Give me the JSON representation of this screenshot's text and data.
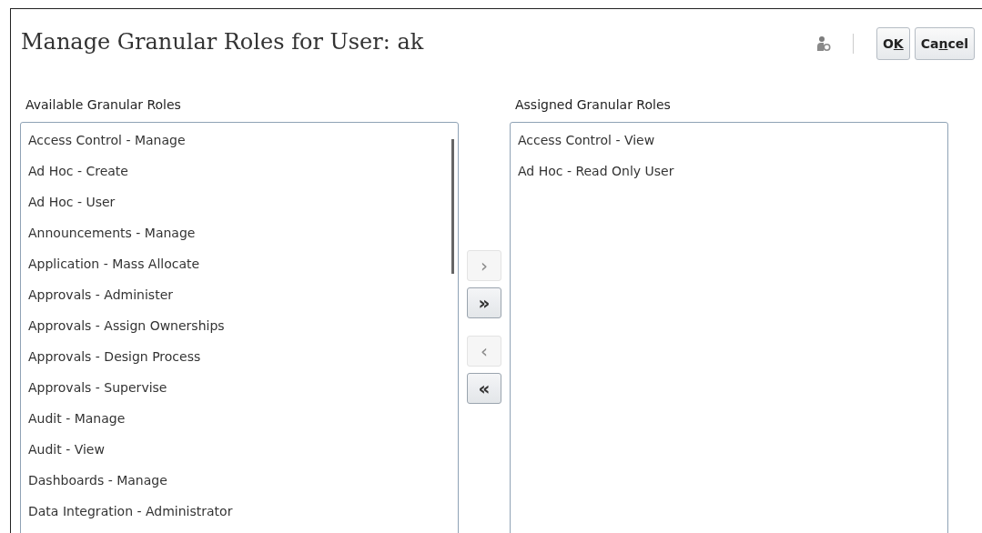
{
  "dialog": {
    "title": "Manage Granular Roles for User: ak",
    "buttons": [
      {
        "parts": [
          {
            "text": "O",
            "underlined": false
          },
          {
            "text": "K",
            "underlined": true
          }
        ]
      },
      {
        "parts": [
          {
            "text": "Ca",
            "underlined": false
          },
          {
            "text": "n",
            "underlined": true
          },
          {
            "text": "cel",
            "underlined": false
          }
        ]
      }
    ]
  },
  "available": {
    "label": "Available Granular Roles",
    "items": [
      {
        "label": "Access Control - Manage"
      },
      {
        "label": "Ad Hoc - Create"
      },
      {
        "label": "Ad Hoc - User"
      },
      {
        "label": "Announcements - Manage"
      },
      {
        "label": "Application - Mass Allocate"
      },
      {
        "label": "Approvals - Administer"
      },
      {
        "label": "Approvals - Assign Ownerships"
      },
      {
        "label": "Approvals - Design Process"
      },
      {
        "label": "Approvals - Supervise"
      },
      {
        "label": "Audit - Manage"
      },
      {
        "label": "Audit - View"
      },
      {
        "label": "Dashboards - Manage"
      },
      {
        "label": "Data Integration - Administrator"
      }
    ]
  },
  "movers": [
    {
      "label": "›",
      "disabled": true
    },
    {
      "label": "»",
      "disabled": false
    },
    {
      "label": "‹",
      "disabled": true
    },
    {
      "label": "«",
      "disabled": false
    }
  ],
  "assigned": {
    "label": "Assigned Granular Roles",
    "items": [
      {
        "label": "Access Control - View"
      },
      {
        "label": "Ad Hoc - Read Only User"
      }
    ]
  }
}
